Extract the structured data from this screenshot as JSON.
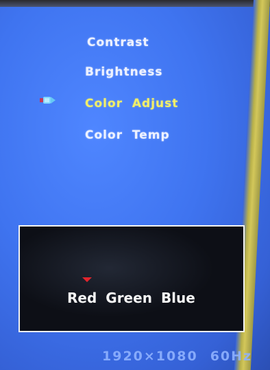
{
  "osd": {
    "menu": {
      "items": [
        {
          "label": "Contrast"
        },
        {
          "label": "Brightness"
        },
        {
          "label": "Color  Adjust",
          "selected": true
        },
        {
          "label": "Color  Temp"
        }
      ],
      "selected_color": "#f2ef68",
      "item_color": "#eef2ff"
    },
    "cursor_icon": "pointer-icon",
    "panel": {
      "channels": [
        "Red",
        "Green",
        "Blue"
      ],
      "selected_channel": "Red",
      "marker_color": "#e2242c"
    },
    "status": {
      "resolution": "1920×1080",
      "refresh": "60Hz"
    },
    "background_color": "#3f74f0"
  }
}
